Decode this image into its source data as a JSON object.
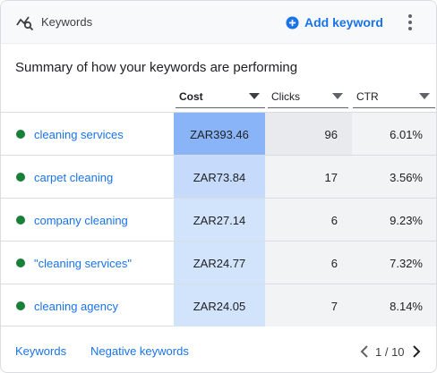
{
  "header": {
    "title": "Keywords",
    "icon": "keyword-insights-icon",
    "add_label": "Add keyword",
    "menu_icon": "more-vert-icon"
  },
  "subtitle": "Summary of how your keywords are performing",
  "columns": [
    {
      "label": "Cost",
      "sorted": true
    },
    {
      "label": "Clicks",
      "sorted": false
    },
    {
      "label": "CTR",
      "sorted": false
    }
  ],
  "rows": [
    {
      "keyword": "cleaning services",
      "cost": "ZAR393.46",
      "clicks": "96",
      "ctr": "6.01%",
      "cost_shade": "#8ab4f8",
      "clicks_shade": "#e8eaed",
      "ctr_shade": "#f1f3f4"
    },
    {
      "keyword": "carpet cleaning",
      "cost": "ZAR73.84",
      "clicks": "17",
      "ctr": "3.56%",
      "cost_shade": "#c6dafc",
      "clicks_shade": "#f1f3f4",
      "ctr_shade": "#f1f3f4"
    },
    {
      "keyword": "company cleaning",
      "cost": "ZAR27.14",
      "clicks": "6",
      "ctr": "9.23%",
      "cost_shade": "#d2e3fc",
      "clicks_shade": "#f1f3f4",
      "ctr_shade": "#f1f3f4"
    },
    {
      "keyword": "\"cleaning services\"",
      "cost": "ZAR24.77",
      "clicks": "6",
      "ctr": "7.32%",
      "cost_shade": "#d2e3fc",
      "clicks_shade": "#f1f3f4",
      "ctr_shade": "#f1f3f4"
    },
    {
      "keyword": "cleaning agency",
      "cost": "ZAR24.05",
      "clicks": "7",
      "ctr": "8.14%",
      "cost_shade": "#d2e3fc",
      "clicks_shade": "#f1f3f4",
      "ctr_shade": "#f1f3f4"
    }
  ],
  "status_color": "#188038",
  "accent_color": "#1a73e8",
  "footer": {
    "keywords_link": "Keywords",
    "negative_link": "Negative keywords",
    "pager": "1 / 10"
  }
}
